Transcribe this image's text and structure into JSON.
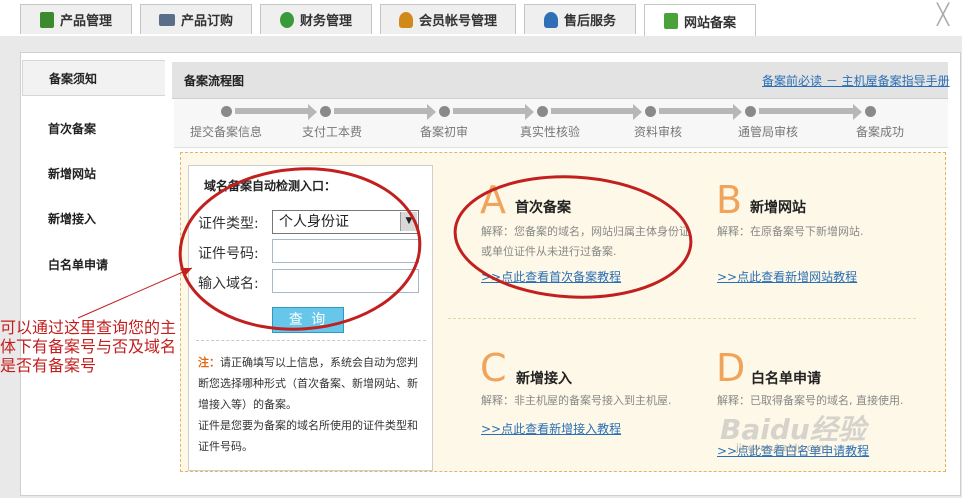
{
  "tabs": [
    {
      "label": "产品管理",
      "icon": "book-icon",
      "color": "#3c8a2e"
    },
    {
      "label": "产品订购",
      "icon": "cart-icon",
      "color": "#5a6e8a"
    },
    {
      "label": "财务管理",
      "icon": "money-bag-icon",
      "color": "#3a9a3a"
    },
    {
      "label": "会员帐号管理",
      "icon": "users-icon",
      "color": "#d08a1a"
    },
    {
      "label": "售后服务",
      "icon": "support-icon",
      "color": "#2e6fb5"
    },
    {
      "label": "网站备案",
      "icon": "record-icon",
      "color": "#4aa23a"
    }
  ],
  "close_glyph": "╳",
  "sidebar": {
    "items": [
      {
        "label": "备案须知"
      },
      {
        "label": "首次备案"
      },
      {
        "label": "新增网站"
      },
      {
        "label": "新增接入"
      },
      {
        "label": "白名单申请"
      }
    ]
  },
  "process": {
    "title": "备案流程图",
    "guide_link": "备案前必读 － 主机屋备案指导手册",
    "steps": [
      "提交备案信息",
      "支付工本费",
      "备案初审",
      "真实性核验",
      "资料审核",
      "通管局审核",
      "备案成功"
    ]
  },
  "form": {
    "title": "域名备案自动检测入口：",
    "id_type_label": "证件类型:",
    "id_type_value": "个人身份证",
    "id_number_label": "证件号码:",
    "domain_label": "输入域名:",
    "query_button": "查 询",
    "note_label": "注：",
    "note_text": "请正确填写以上信息，系统会自动为您判断您选择哪种形式（首次备案、新增网站、新增接入等）的备案。",
    "note_text2": "证件是您要为备案的域名所使用的证件类型和证件号码。"
  },
  "options": [
    {
      "letter": "A",
      "title": "首次备案",
      "desc": "解释：您备案的域名，网站归属主体身份证或单位证件从未进行过备案.",
      "link": ">>点此查看首次备案教程"
    },
    {
      "letter": "B",
      "title": "新增网站",
      "desc": "解释：在原备案号下新增网站.",
      "link": ">>点此查看新增网站教程"
    },
    {
      "letter": "C",
      "title": "新增接入",
      "desc": "解释：非主机屋的备案号接入到主机屋.",
      "link": ">>点此查看新增接入教程"
    },
    {
      "letter": "D",
      "title": "白名单申请",
      "desc": "解释：已取得备案号的域名, 直接使用.",
      "link": ">>点此查看白名单申请教程"
    }
  ],
  "annotation": "可以通过这里查询您的主体下有备案号与否及域名是否有备案号",
  "watermark": "Baidu经验",
  "watermark_url": "jingyan.baidu.com",
  "colors": {
    "annotation": "#c21f1f",
    "accent_orange": "#f0a35a",
    "link": "#2a6fb5",
    "query_button": "#67c7ea"
  }
}
